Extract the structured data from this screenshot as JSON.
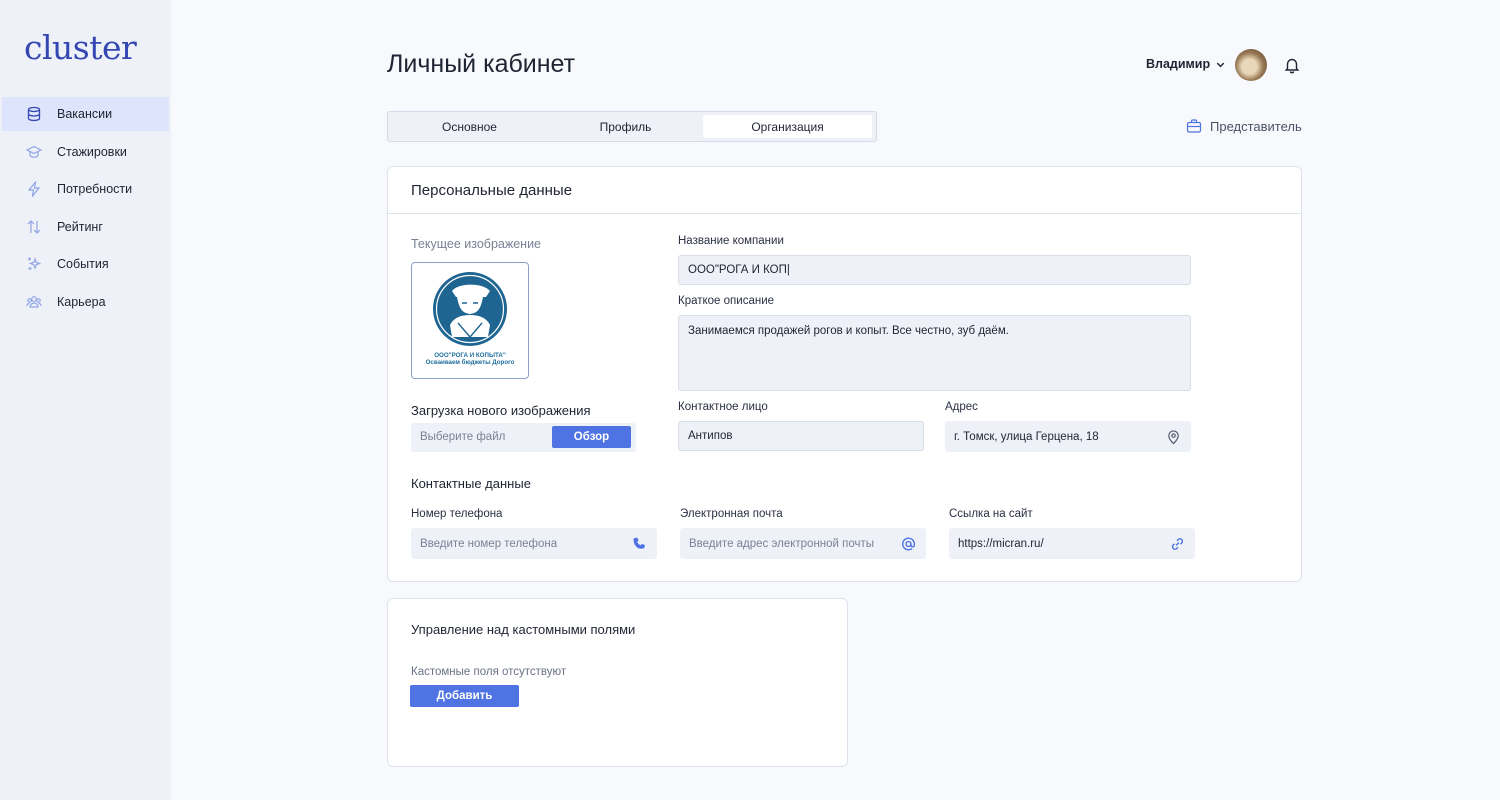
{
  "brand": {
    "logo": "cluster",
    "accent": "#4f73e3"
  },
  "sidebar": {
    "items": [
      {
        "label": "Вакансии",
        "icon": "database-icon",
        "active": true
      },
      {
        "label": "Стажировки",
        "icon": "graduation-cap-icon"
      },
      {
        "label": "Потребности",
        "icon": "lightning-icon"
      },
      {
        "label": "Рейтинг",
        "icon": "sort-arrows-icon"
      },
      {
        "label": "События",
        "icon": "sparkles-icon"
      },
      {
        "label": "Карьера",
        "icon": "people-icon"
      }
    ]
  },
  "header": {
    "title": "Личный кабинет",
    "user_name": "Владимир"
  },
  "tabs": {
    "items": [
      {
        "label": "Основное"
      },
      {
        "label": "Профиль"
      },
      {
        "label": "Организация",
        "active": true
      }
    ]
  },
  "representative": {
    "label": "Представитель"
  },
  "personal": {
    "title": "Персональные данные",
    "current_image_label": "Текущее изображение",
    "logo_caption_1": "ООО\"РОГА И КОПЫТА\"",
    "logo_caption_2": "Осваиваем бюджеты Дорого",
    "upload_label": "Загрузка нового изображения",
    "file_placeholder": "Выберите файл",
    "browse_button": "Обзор",
    "company_name_label": "Название компании",
    "company_name_value": "ООО\"РОГА И КОП|",
    "description_label": "Краткое описание",
    "description_value": "Занимаемся продажей рогов и копыт. Все честно, зуб даём.",
    "contact_person_label": "Контактное лицо",
    "contact_person_value": "Антипов",
    "address_label": "Адрес",
    "address_value": "г. Томск, улица Герцена, 18",
    "contacts_title": "Контактные данные",
    "phone_label": "Номер телефона",
    "phone_placeholder": "Введите номер телефона",
    "email_label": "Электронная почта",
    "email_placeholder": "Введите адрес электронной почты",
    "site_label": "Ссылка на сайт",
    "site_value": "https://micran.ru/"
  },
  "custom_fields": {
    "title": "Управление над кастомными полями",
    "empty_text": "Кастомные поля отсутствуют",
    "add_button": "Добавить"
  }
}
